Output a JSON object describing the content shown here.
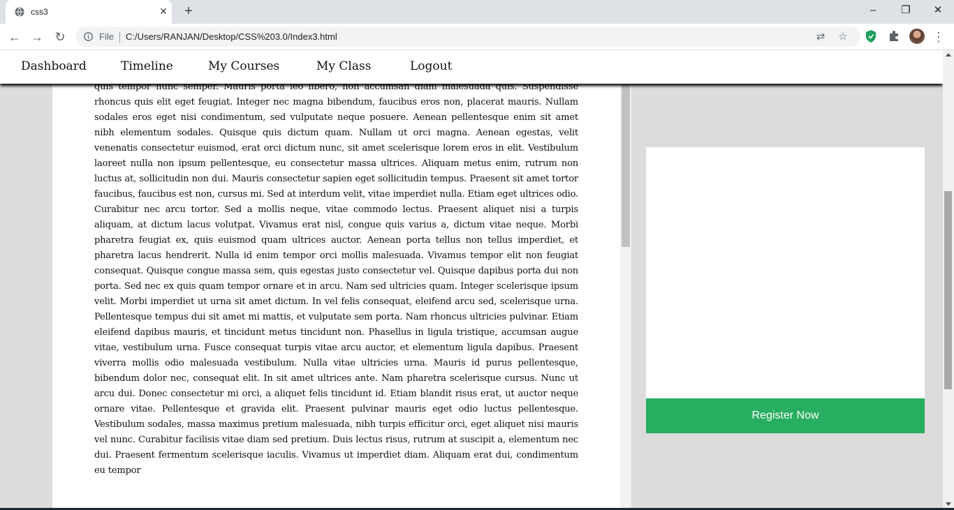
{
  "browser": {
    "tab_title": "css3",
    "url": "C:/Users/RANJAN/Desktop/CSS%203.0/Index3.html",
    "file_label": "File",
    "icons": [
      "globe-icon",
      "close-icon",
      "plus-icon",
      "minimize-icon",
      "restore-icon",
      "window-close-icon",
      "back-icon",
      "forward-icon",
      "reload-icon",
      "info-icon",
      "translate-icon",
      "star-icon",
      "shield-extension-icon",
      "puzzle-icon",
      "profile-avatar",
      "menu-icon"
    ]
  },
  "navbar": {
    "items": [
      "Dashboard",
      "Timeline",
      "My Courses",
      "My Class",
      "Logout"
    ]
  },
  "article": {
    "text": "diam. Sed sollicitudin turpis vitae arcu maximus ornare blandit sit amet magna. Etiam nec feugiat felis. Vivamus finibus finibus dui non egestas. Nunc vitae nisl risus. Ut euismod eros ut ipsum condimentum, quis tempor nunc semper. Mauris porta leo libero, non accumsan diam malesuada quis. Suspendisse rhoncus quis elit eget feugiat. Integer nec magna bibendum, faucibus eros non, placerat mauris. Nullam sodales eros eget nisi condimentum, sed vulputate neque posuere. Aenean pellentesque enim sit amet nibh elementum sodales. Quisque quis dictum quam. Nullam ut orci magna. Aenean egestas, velit venenatis consectetur euismod, erat orci dictum nunc, sit amet scelerisque lorem eros in elit. Vestibulum laoreet nulla non ipsum pellentesque, eu consectetur massa ultrices. Aliquam metus enim, rutrum non luctus at, sollicitudin non dui. Mauris consectetur sapien eget sollicitudin tempus. Praesent sit amet tortor faucibus, faucibus est non, cursus mi. Sed at interdum velit, vitae imperdiet nulla. Etiam eget ultrices odio. Curabitur nec arcu tortor. Sed a mollis neque, vitae commodo lectus. Praesent aliquet nisi a turpis aliquam, at dictum lacus volutpat. Vivamus erat nisl, congue quis varius a, dictum vitae neque. Morbi pharetra feugiat ex, quis euismod quam ultrices auctor. Aenean porta tellus non tellus imperdiet, et pharetra lacus hendrerit. Nulla id enim tempor orci mollis malesuada. Vivamus tempor elit non feugiat consequat. Quisque congue massa sem, quis egestas justo consectetur vel. Quisque dapibus porta dui non porta. Sed nec ex quis quam tempor ornare et in arcu. Nam sed ultricies quam. Integer scelerisque ipsum velit. Morbi imperdiet ut urna sit amet dictum. In vel felis consequat, eleifend arcu sed, scelerisque urna. Pellentesque tempus dui sit amet mi mattis, et vulputate sem porta. Nam rhoncus ultricies pulvinar. Etiam eleifend dapibus mauris, et tincidunt metus tincidunt non. Phasellus in ligula tristique, accumsan augue vitae, vestibulum urna. Fusce consequat turpis vitae arcu auctor, et elementum ligula dapibus. Praesent viverra mollis odio malesuada vestibulum. Nulla vitae ultricies urna. Mauris id purus pellentesque, bibendum dolor nec, consequat elit. In sit amet ultrices ante. Nam pharetra scelerisque cursus. Nunc ut arcu dui. Donec consectetur mi orci, a aliquet felis tincidunt id. Etiam blandit risus erat, ut auctor neque ornare vitae. Pellentesque et gravida elit. Praesent pulvinar mauris eget odio luctus pellentesque. Vestibulum sodales, massa maximus pretium malesuada, nibh turpis efficitur orci, eget aliquet nisi mauris vel nunc. Curabitur facilisis vitae diam sed pretium. Duis lectus risus, rutrum at suscipit a, elementum nec dui. Praesent fermentum scelerisque iaculis. Vivamus ut imperdiet diam. Aliquam erat dui, condimentum eu tempor"
  },
  "sidebar": {
    "register_label": "Register Now",
    "register_color": "#27ae60"
  }
}
